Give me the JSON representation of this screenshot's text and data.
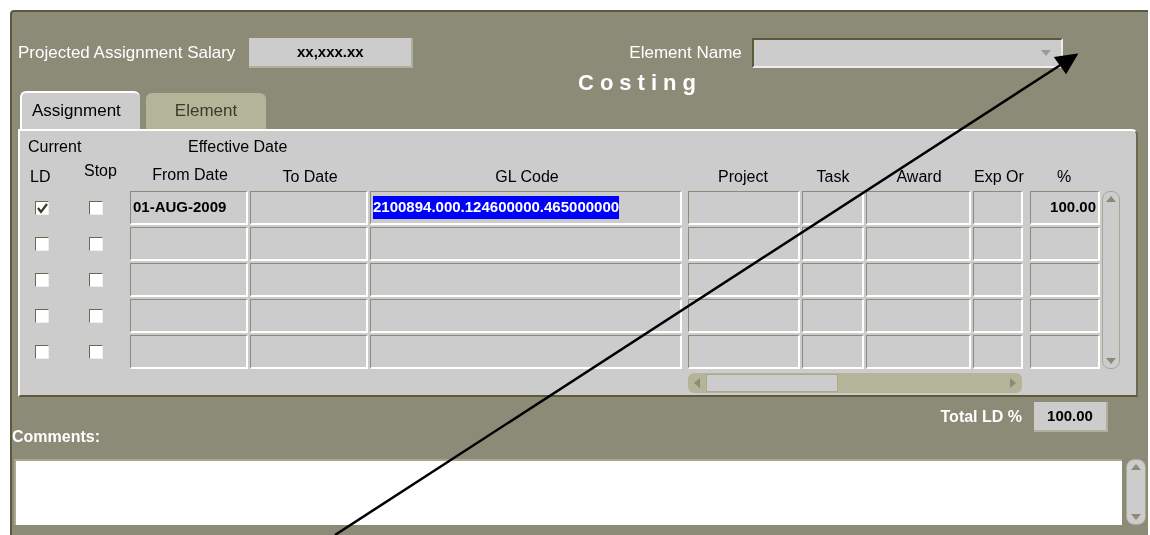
{
  "header": {
    "salary_label": "Projected Assignment Salary",
    "salary_value": "xx,xxx.xx",
    "element_label": "Element Name"
  },
  "title": "Costing",
  "tabs": [
    {
      "label": "Assignment",
      "selected": true
    },
    {
      "label": "Element",
      "selected": false
    }
  ],
  "column_groups": {
    "current": "Current",
    "effective_date": "Effective Date"
  },
  "columns": {
    "ld": "LD",
    "stop": "Stop",
    "from_date": "From Date",
    "to_date": "To Date",
    "gl_code": "GL Code",
    "project": "Project",
    "task": "Task",
    "award": "Award",
    "exp_org": "Exp Or",
    "percent": "%"
  },
  "rows": [
    {
      "ld": true,
      "stop": false,
      "from_date": "01-AUG-2009",
      "gl_code": "2100894.000.124600000.465000000",
      "gl_highlighted": true,
      "percent": "100.00"
    },
    {
      "ld": false,
      "stop": false
    },
    {
      "ld": false,
      "stop": false
    },
    {
      "ld": false,
      "stop": false
    },
    {
      "ld": false,
      "stop": false
    }
  ],
  "total": {
    "label": "Total LD %",
    "value": "100.00"
  },
  "comments": {
    "label": "Comments:"
  }
}
